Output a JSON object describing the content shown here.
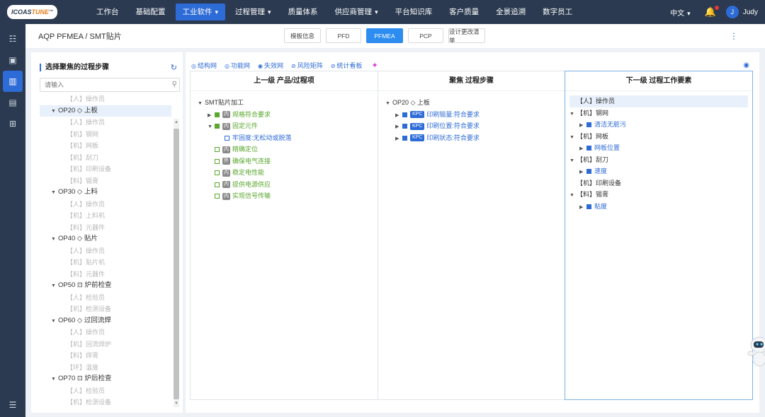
{
  "brand": {
    "logo_text_a": "ICOAS",
    "logo_text_b": "TUNE",
    "tm": "™",
    "accent": "#2d6bd6",
    "topbar_bg": "#2b3a50"
  },
  "nav": {
    "items": [
      {
        "label": "工作台",
        "chevron": false,
        "active": false
      },
      {
        "label": "基础配置",
        "chevron": false,
        "active": false
      },
      {
        "label": "工业软件",
        "chevron": true,
        "active": true
      },
      {
        "label": "过程管理",
        "chevron": true,
        "active": false
      },
      {
        "label": "质量体系",
        "chevron": false,
        "active": false
      },
      {
        "label": "供应商管理",
        "chevron": true,
        "active": false
      },
      {
        "label": "平台知识库",
        "chevron": false,
        "active": false
      },
      {
        "label": "客户质量",
        "chevron": false,
        "active": false
      },
      {
        "label": "全景追溯",
        "chevron": false,
        "active": false
      },
      {
        "label": "数字员工",
        "chevron": false,
        "active": false
      }
    ],
    "language": "中文",
    "user_initial": "J",
    "user_name": "Judy"
  },
  "sidebar": {
    "icons": [
      "list-icon",
      "calendar-icon",
      "layout-icon",
      "books-icon",
      "org-chart-icon"
    ],
    "bottom": "collapse-icon"
  },
  "header": {
    "breadcrumb": "AQP PFMEA / SMT贴片",
    "tabs": [
      {
        "label": "模板信息",
        "active": false
      },
      {
        "label": "PFD",
        "active": false
      },
      {
        "label": "PFMEA",
        "active": true
      },
      {
        "label": "PCP",
        "active": false
      },
      {
        "label": "设计更改清单",
        "active": false
      }
    ]
  },
  "left_panel": {
    "title": "选择聚焦的过程步骤",
    "search_placeholder": "请输入",
    "tree": [
      {
        "text": "【人】操作员",
        "type": "leaf"
      },
      {
        "text": "OP20 ◇ 上板",
        "type": "op",
        "selected": true
      },
      {
        "text": "【人】操作员",
        "type": "leaf"
      },
      {
        "text": "【机】钢网",
        "type": "leaf"
      },
      {
        "text": "【机】网板",
        "type": "leaf"
      },
      {
        "text": "【机】刮刀",
        "type": "leaf"
      },
      {
        "text": "【机】印刷设备",
        "type": "leaf"
      },
      {
        "text": "【料】锡膏",
        "type": "leaf"
      },
      {
        "text": "OP30 ◇ 上料",
        "type": "op"
      },
      {
        "text": "【人】操作员",
        "type": "leaf"
      },
      {
        "text": "【机】上料机",
        "type": "leaf"
      },
      {
        "text": "【料】元器件",
        "type": "leaf"
      },
      {
        "text": "OP40 ◇ 贴片",
        "type": "op"
      },
      {
        "text": "【人】操作员",
        "type": "leaf"
      },
      {
        "text": "【机】贴片机",
        "type": "leaf"
      },
      {
        "text": "【料】元器件",
        "type": "leaf"
      },
      {
        "text": "OP50 ⊡ 炉前检查",
        "type": "op"
      },
      {
        "text": "【人】检验员",
        "type": "leaf"
      },
      {
        "text": "【机】检测设备",
        "type": "leaf"
      },
      {
        "text": "OP60 ◇ 过回流焊",
        "type": "op"
      },
      {
        "text": "【人】操作员",
        "type": "leaf"
      },
      {
        "text": "【机】回流焊炉",
        "type": "leaf"
      },
      {
        "text": "【料】焊膏",
        "type": "leaf"
      },
      {
        "text": "【环】温度",
        "type": "leaf"
      },
      {
        "text": "OP70 ⊡ 炉后检查",
        "type": "op"
      },
      {
        "text": "【人】检验员",
        "type": "leaf"
      },
      {
        "text": "【机】检测设备",
        "type": "leaf"
      }
    ]
  },
  "main": {
    "subtabs": [
      {
        "label": "结构网",
        "icon": "◎"
      },
      {
        "label": "功能网",
        "icon": "◎"
      },
      {
        "label": "失效网",
        "icon": "◉"
      },
      {
        "label": "风险矩阵",
        "icon": "⊘"
      },
      {
        "label": "统计看板",
        "icon": "⊘"
      }
    ],
    "col1": {
      "title": "上一级 产品/过程项",
      "rows": [
        {
          "indent": 0,
          "tri": "▼",
          "text": "SMT贴片加工",
          "color": "dark"
        },
        {
          "indent": 1,
          "tri": "▶",
          "sq": "gf",
          "badge": "内",
          "text": "规格符合要求",
          "color": "g"
        },
        {
          "indent": 1,
          "tri": "▼",
          "sq": "gf",
          "badge": "内",
          "text": "固定元件",
          "color": "g"
        },
        {
          "indent": 2,
          "sq": "bo",
          "text": "牢固度:无松动或脱落",
          "color": "b"
        },
        {
          "indent": 1,
          "sq": "go",
          "badge": "内",
          "text": "精确定位",
          "color": "g"
        },
        {
          "indent": 1,
          "sq": "go",
          "badge": "外",
          "text": "确保电气连接",
          "color": "g"
        },
        {
          "indent": 1,
          "sq": "go",
          "badge": "内",
          "text": "稳定电性能",
          "color": "g"
        },
        {
          "indent": 1,
          "sq": "go",
          "badge": "内",
          "text": "提供电源供应",
          "color": "g"
        },
        {
          "indent": 1,
          "sq": "go",
          "badge": "内",
          "text": "实现信号传输",
          "color": "g"
        }
      ]
    },
    "col2": {
      "title": "聚焦 过程步骤",
      "rows": [
        {
          "indent": 0,
          "tri": "▼",
          "text": "OP20 ◇ 上板",
          "color": "dark"
        },
        {
          "indent": 1,
          "tri": "▶",
          "sq": "bf",
          "badge": "KPC",
          "text": "印刷锡量:符合要求",
          "color": "b"
        },
        {
          "indent": 1,
          "tri": "▶",
          "sq": "bf",
          "badge": "KPC",
          "text": "印刷位置:符合要求",
          "color": "b"
        },
        {
          "indent": 1,
          "tri": "▶",
          "sq": "bf",
          "badge": "KPC",
          "text": "印刷状态:符合要求",
          "color": "b"
        }
      ]
    },
    "col3": {
      "title": "下一级 过程工作要素",
      "rows": [
        {
          "indent": 0,
          "text": "【人】操作员",
          "color": "dark",
          "selected": true
        },
        {
          "indent": 0,
          "tri": "▼",
          "text": "【机】钢网",
          "color": "dark"
        },
        {
          "indent": 1,
          "tri": "▶",
          "sq": "bf",
          "text": "清洁无脏污",
          "color": "b"
        },
        {
          "indent": 0,
          "tri": "▼",
          "text": "【机】网板",
          "color": "dark"
        },
        {
          "indent": 1,
          "tri": "▶",
          "sq": "bf",
          "text": "网板位置",
          "color": "b"
        },
        {
          "indent": 0,
          "tri": "▼",
          "text": "【机】刮刀",
          "color": "dark"
        },
        {
          "indent": 1,
          "tri": "▶",
          "sq": "bf",
          "text": "速度",
          "color": "b"
        },
        {
          "indent": 0,
          "text": "【机】印刷设备",
          "color": "dark"
        },
        {
          "indent": 0,
          "tri": "▼",
          "text": "【料】锡膏",
          "color": "dark"
        },
        {
          "indent": 1,
          "tri": "▶",
          "sq": "bf",
          "text": "粘度",
          "color": "b"
        }
      ]
    }
  }
}
